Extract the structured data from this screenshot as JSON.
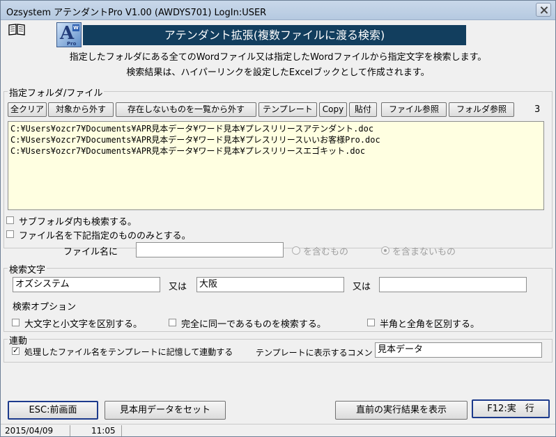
{
  "window": {
    "title": "Ozsystem アテンダントPro V1.00 (AWDYS701)  LogIn:USER"
  },
  "header": {
    "logo_letter": "A",
    "logo_badge": "W",
    "logo_sub": "Pro",
    "banner": "アテンダント拡張(複数ファイルに渡る検索)",
    "desc_line1": "指定したフォルダにある全てのWordファイル又は指定したWordファイルから指定文字を検索します。",
    "desc_line2": "検索結果は、ハイパーリンクを設定したExcelブックとして作成されます。"
  },
  "folder_group": {
    "label": "指定フォルダ/ファイル",
    "buttons": {
      "clear_all": "全クリア",
      "remove_from_target": "対象から外す",
      "remove_missing": "存在しないものを一覧から外す",
      "template": "テンプレート",
      "copy": "Copy",
      "paste": "貼付",
      "file_browse": "ファイル参照",
      "folder_browse": "フォルダ参照"
    },
    "count": "3",
    "files": [
      "C:¥Users¥ozcr7¥Documents¥APR見本データ¥ワード見本¥プレスリリースアテンダント.doc",
      "C:¥Users¥ozcr7¥Documents¥APR見本データ¥ワード見本¥プレスリリースいいお客様Pro.doc",
      "C:¥Users¥ozcr7¥Documents¥APR見本データ¥ワード見本¥プレスリリースエゴキット.doc"
    ],
    "subfolder_label": "サブフォルダ内も検索する。",
    "filename_only_label": "ファイル名を下記指定のもののみとする。",
    "filename_label": "ファイル名に",
    "filename_value": "",
    "include_label": "を含むもの",
    "exclude_label": "を含まないもの"
  },
  "search_group": {
    "label": "検索文字",
    "term1": "オズシステム",
    "or1": "又は",
    "term2": "大阪",
    "or2": "又は",
    "term3": "",
    "options_label": "検索オプション",
    "opt_case": "大文字と小文字を区別する。",
    "opt_exact": "完全に同一であるものを検索する。",
    "opt_width": "半角と全角を区別する。"
  },
  "link_group": {
    "label": "連動",
    "remember_label": "処理したファイル名をテンプレートに記憶して連動する",
    "comment_label": "テンプレートに表示するコメント",
    "comment_value": "見本データ"
  },
  "footer": {
    "esc": "ESC:前画面",
    "set_sample": "見本用データをセット",
    "show_last": "直前の実行結果を表示",
    "run": "F12:実　行"
  },
  "status": {
    "date": "2015/04/09",
    "time": "11:05"
  }
}
